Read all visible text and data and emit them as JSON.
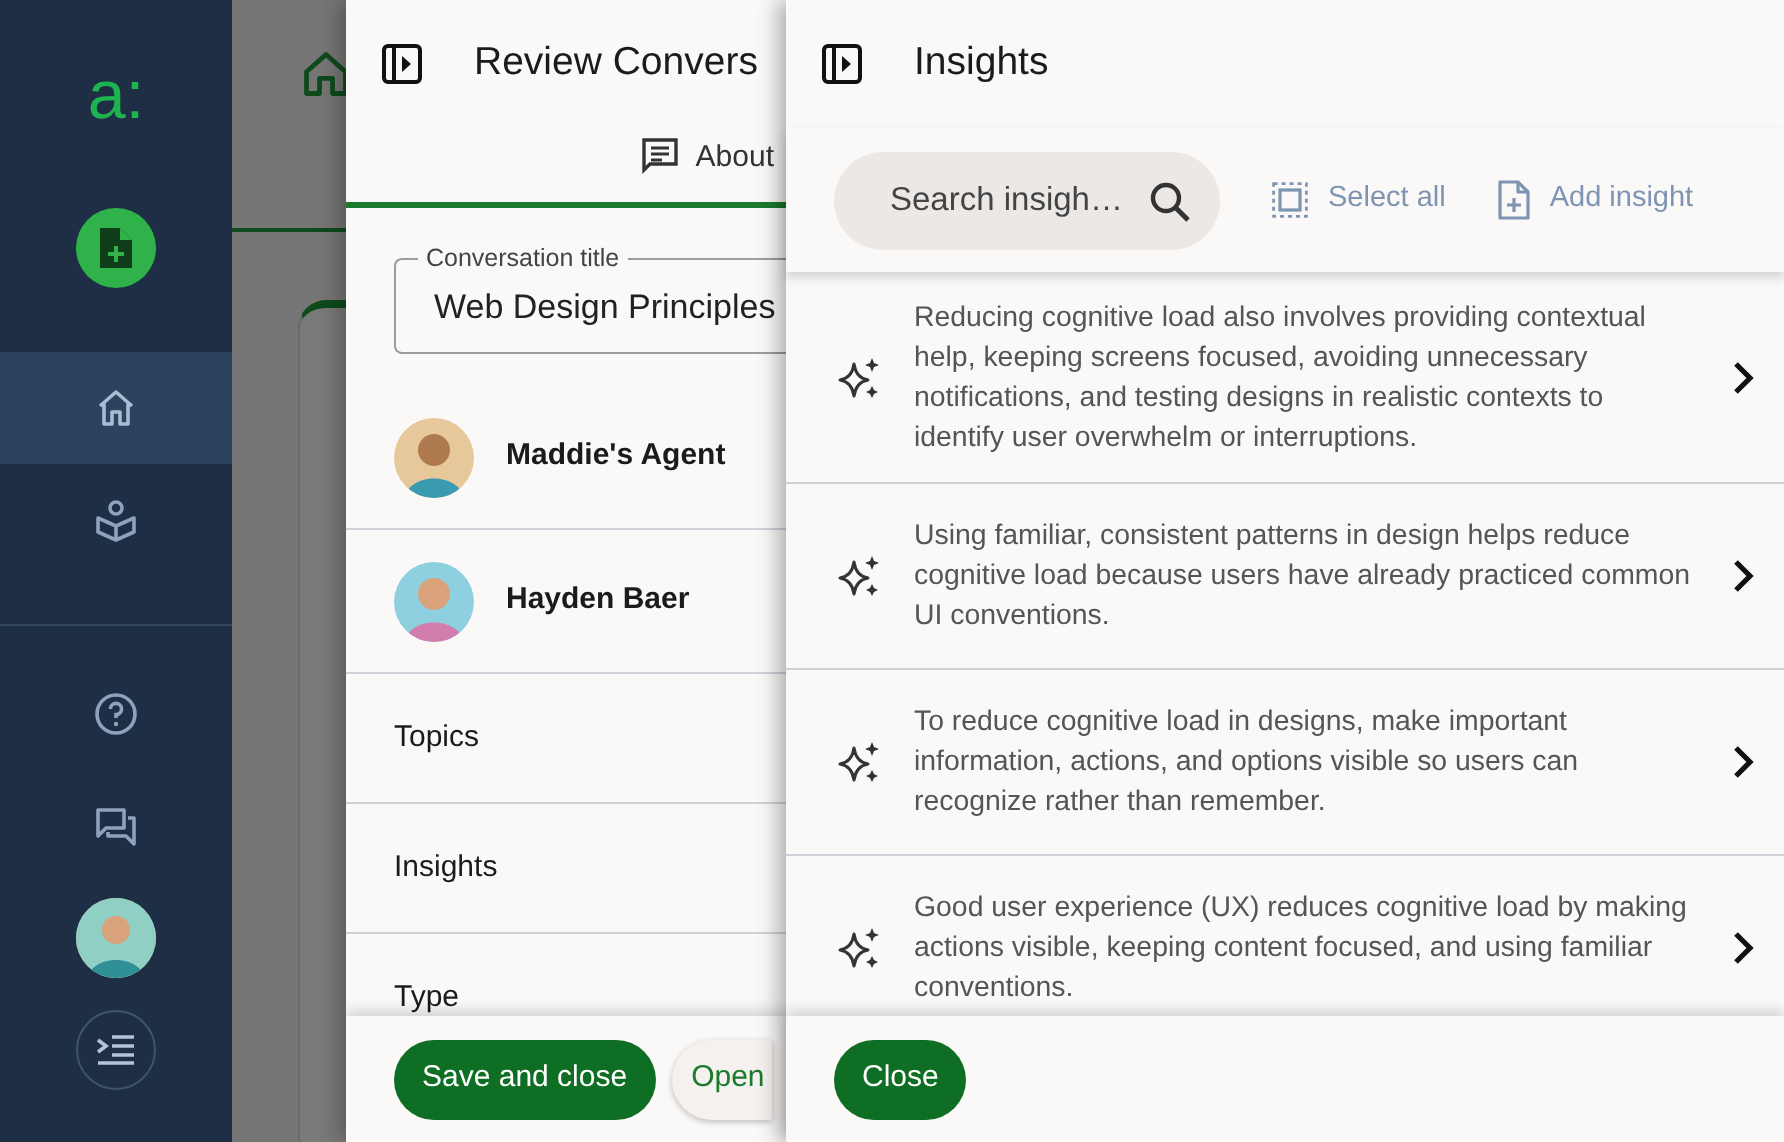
{
  "sidebar": {
    "logo": "a:",
    "actions": [
      {
        "kind": "new"
      }
    ],
    "nav": [
      {
        "kind": "home",
        "selected": true
      },
      {
        "kind": "learn",
        "selected": false
      }
    ],
    "tools": [
      {
        "kind": "help"
      },
      {
        "kind": "chat"
      },
      {
        "kind": "avatar"
      },
      {
        "kind": "collapse"
      }
    ]
  },
  "review_panel": {
    "title": "Review Convers",
    "tabs": [
      {
        "label": "About",
        "selected": true
      }
    ],
    "title_field": {
      "label": "Conversation title",
      "value": "Web Design Principles"
    },
    "participants": [
      {
        "name": "Maddie's Agent"
      },
      {
        "name": "Hayden Baer"
      }
    ],
    "sections": [
      "Topics",
      "Insights",
      "Type"
    ],
    "buttons": [
      {
        "label": "Save and close",
        "kind": "primary"
      },
      {
        "label": "Open",
        "kind": "secondary"
      }
    ]
  },
  "insights_panel": {
    "title": "Insights",
    "search": {
      "placeholder": "Search insigh…"
    },
    "actions": [
      {
        "label": "Select all",
        "kind": "select"
      },
      {
        "label": "Add insight",
        "kind": "add"
      }
    ],
    "items": [
      {
        "text": "Reducing cognitive load also involves providing contextual help, keeping screens focused, avoiding unnecessary notifications, and testing designs in realistic contexts to identify user overwhelm or interruptions."
      },
      {
        "text": "Using familiar, consistent patterns in design helps reduce cognitive load because users have already practiced common UI conventions."
      },
      {
        "text": "To reduce cognitive load in designs, make important information, actions, and options visible so users can recognize rather than remember."
      },
      {
        "text": "Good user experience (UX) reduces cognitive load by making actions visible, keeping content focused, and using familiar conventions."
      }
    ],
    "buttons": [
      {
        "label": "Close",
        "kind": "primary"
      }
    ]
  }
}
